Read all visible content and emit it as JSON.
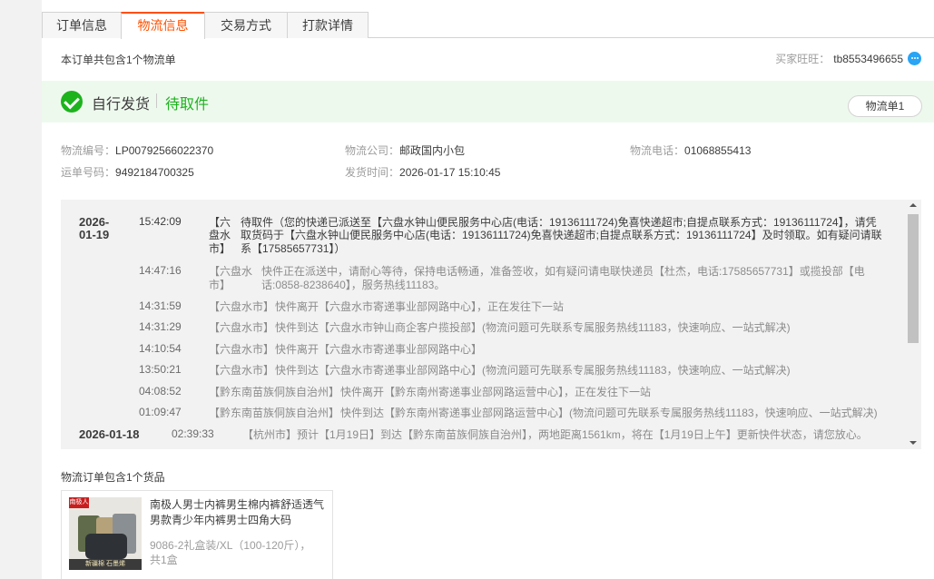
{
  "tabs": [
    {
      "label": "订单信息"
    },
    {
      "label": "物流信息"
    },
    {
      "label": "交易方式"
    },
    {
      "label": "打款详情"
    }
  ],
  "summary": "本订单共包含1个物流单",
  "buyer": {
    "label": "买家旺旺：",
    "value": "tb8553496655"
  },
  "status": {
    "main": "自行发货",
    "sub": "待取件",
    "shipment_button": "物流单1"
  },
  "info": {
    "tracking_no_label": "物流编号：",
    "tracking_no": "LP00792566022370",
    "company_label": "物流公司：",
    "company": "邮政国内小包",
    "phone_label": "物流电话：",
    "phone": "01068855413",
    "waybill_label": "运单号码：",
    "waybill": "9492184700325",
    "ship_time_label": "发货时间：",
    "ship_time": "2026-01-17 15:10:45"
  },
  "tracking": [
    {
      "date": "2026-",
      "date2": "01-19",
      "time": "15:42:09",
      "city": "【六",
      "city2": "盘水",
      "city3": "市】",
      "msg": "待取件（您的快递已派送至【六盘水钟山便民服务中心店(电话：19136111724)免喜快递超市;自提点联系方式：19136111724】，请凭",
      "msg2": "取货码于【六盘水钟山便民服务中心店(电话：19136111724)免喜快递超市;自提点联系方式：19136111724】及时领取。如有疑问请联",
      "msg3": "系【17585657731】）"
    },
    {
      "time": "14:47:16",
      "city": "【六盘水",
      "city2": "市】",
      "msg": "快件正在派送中，请耐心等待，保持电话畅通，准备签收，如有疑问请电联快递员【杜杰，电话:17585657731】或揽投部【电",
      "msg2": "话:0858-8238640】，服务热线11183。"
    },
    {
      "time": "14:31:59",
      "city": "【六盘水市】",
      "msg": "快件离开【六盘水市寄递事业部网路中心】，正在发往下一站"
    },
    {
      "time": "14:31:29",
      "city": "【六盘水市】",
      "msg": "快件到达【六盘水市钟山商企客户揽投部】(物流问题可先联系专属服务热线11183，快速响应、一站式解决)"
    },
    {
      "time": "14:10:54",
      "city": "【六盘水市】",
      "msg": "快件离开【六盘水市寄递事业部网路中心】"
    },
    {
      "time": "13:50:21",
      "city": "【六盘水市】",
      "msg": "快件到达【六盘水市寄递事业部网路中心】(物流问题可先联系专属服务热线11183，快速响应、一站式解决)"
    },
    {
      "time": "04:08:52",
      "city": "【黔东南苗族侗族自治州】",
      "msg": "快件离开【黔东南州寄递事业部网路运营中心】，正在发往下一站"
    },
    {
      "time": "01:09:47",
      "city": "【黔东南苗族侗族自治州】",
      "msg": "快件到达【黔东南州寄递事业部网路运营中心】(物流问题可先联系专属服务热线11183，快速响应、一站式解决)"
    },
    {
      "date": "2026-01-18",
      "time": "02:39:33",
      "city": "【杭州市】",
      "msg": "预计【1月19日】到达【黔东南苗族侗族自治州】，两地距离1561km，将在【1月19日上午】更新快件状态，请您放心。"
    }
  ],
  "goods": {
    "title": "物流订单包含1个货品",
    "name": "南极人男士内裤男生棉内裤舒适透气男款青少年内裤男士四角大码",
    "spec": "9086-2礼盒装/XL（100-120斤），",
    "qty": "共1盒",
    "image_tag": "南极人",
    "image_bar": "新疆棉 石墨烯"
  },
  "colors": {
    "accent": "#ff5000",
    "success": "#1db31d"
  }
}
